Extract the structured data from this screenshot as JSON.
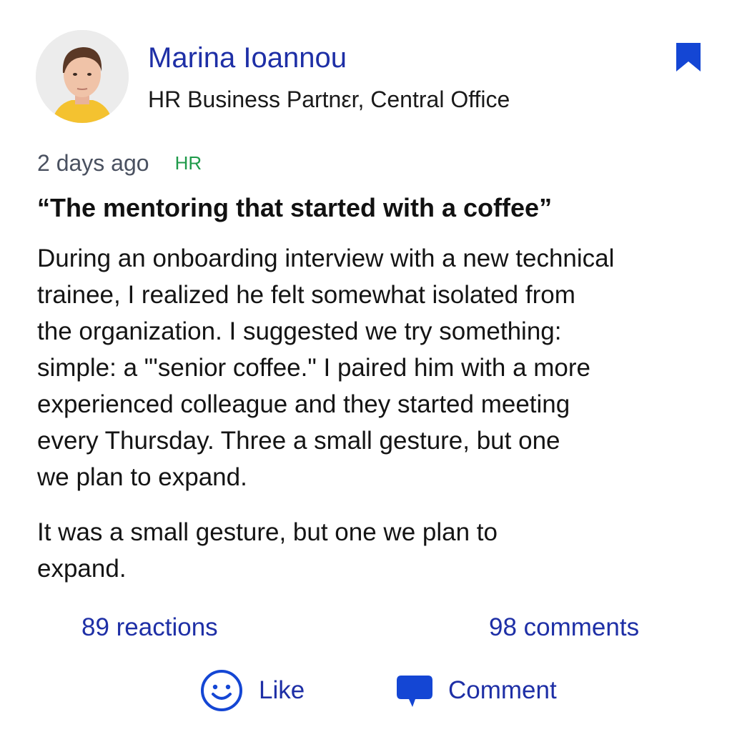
{
  "colors": {
    "accent": "#1e2fa6",
    "tag": "#1f9a4a",
    "muted": "#4a5160",
    "text": "#141414"
  },
  "author": {
    "name": "Marina Ioannou",
    "role": "HR Business Partnεr, Central Office",
    "avatar_icon": "person-portrait"
  },
  "post": {
    "time": "2 days ago",
    "tag": "HR",
    "title": "“The mentoring that started with a coffee”",
    "lines_1": [
      "During an onboarding interview with a new technical",
      "trainee, I realized he felt somewhat isolated from",
      "the organization. I suggested we try something:",
      "simple: a \"'senior coffee.\" I paired him with a more",
      "experienced colleague and they started meeting",
      "every Thursday. Three a small gesture, but one",
      "we plan to expand."
    ],
    "lines_2": [
      "It was a small gesture, but one we plan to",
      "expand."
    ]
  },
  "stats": {
    "reactions": "89 reactions",
    "comments": "98 comments"
  },
  "actions": {
    "like_label": "Like",
    "like_icon": "smiley-icon",
    "comment_label": "Comment",
    "comment_icon": "speech-bubble-icon",
    "bookmark_icon": "bookmark-icon"
  }
}
